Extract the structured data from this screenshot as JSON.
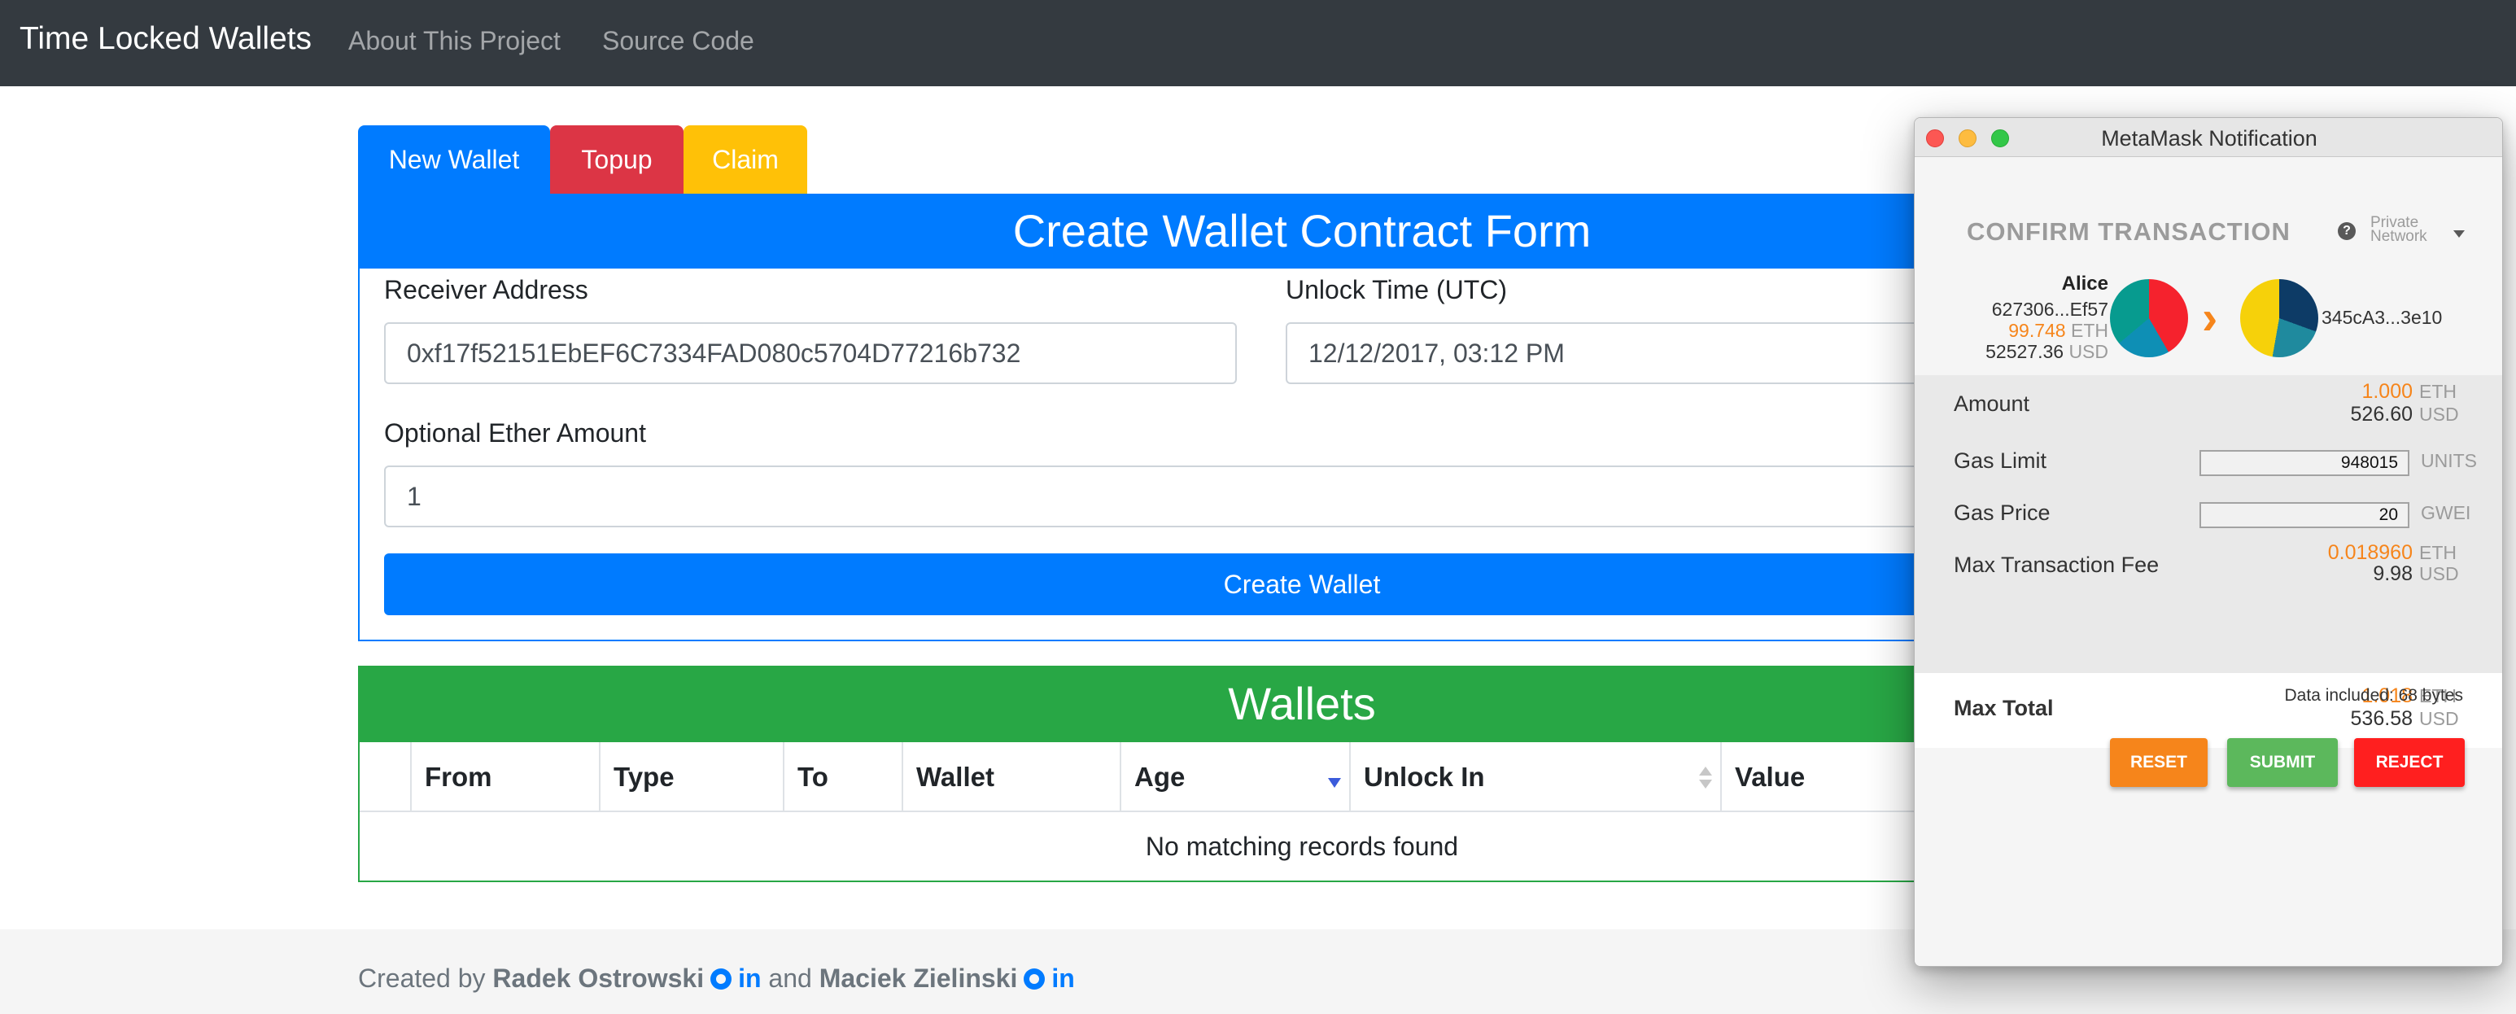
{
  "navbar": {
    "brand": "Time Locked Wallets",
    "links": [
      "About This Project",
      "Source Code"
    ]
  },
  "tabs": {
    "new_wallet": "New Wallet",
    "topup": "Topup",
    "claim": "Claim"
  },
  "form": {
    "title": "Create Wallet Contract Form",
    "receiver_label": "Receiver Address",
    "receiver_value": "0xf17f52151EbEF6C7334FAD080c5704D77216b732",
    "unlock_label": "Unlock Time (UTC)",
    "unlock_value": "12/12/2017, 03:12 PM",
    "amount_label": "Optional Ether Amount",
    "amount_value": "1",
    "submit_label": "Create Wallet"
  },
  "wallets": {
    "title": "Wallets",
    "columns": [
      "From",
      "Type",
      "To",
      "Wallet",
      "Age",
      "Unlock In",
      "Value"
    ],
    "empty_message": "No matching records found"
  },
  "footer": {
    "prefix": "Created by",
    "author1": "Radek Ostrowski",
    "joiner": "and",
    "author2": "Maciek Zielinski",
    "linkedin_label": "in"
  },
  "metamask": {
    "window_title": "MetaMask Notification",
    "heading": "CONFIRM TRANSACTION",
    "network_line1": "Private",
    "network_line2": "Network",
    "from": {
      "name": "Alice",
      "address": "627306...Ef57",
      "eth_balance": "99.748",
      "eth_unit": "ETH",
      "usd_balance": "52527.36",
      "usd_unit": "USD"
    },
    "to_address": "345cA3...3e10",
    "amount": {
      "label": "Amount",
      "eth": "1.000",
      "usd": "526.60"
    },
    "gas_limit": {
      "label": "Gas Limit",
      "value": "948015",
      "unit": "UNITS"
    },
    "gas_price": {
      "label": "Gas Price",
      "value": "20",
      "unit": "GWEI"
    },
    "max_fee": {
      "label": "Max Transaction Fee",
      "eth": "0.018960",
      "usd": "9.98"
    },
    "max_total": {
      "label": "Max Total",
      "eth": "1.018",
      "usd": "536.58"
    },
    "units": {
      "eth": "ETH",
      "usd": "USD"
    },
    "data_included": "Data included: 68 bytes",
    "buttons": {
      "reset": "RESET",
      "submit": "SUBMIT",
      "reject": "REJECT"
    }
  },
  "colors": {
    "navbar": "#343a40",
    "primary": "#007bff",
    "danger": "#dc3545",
    "warning": "#ffc107",
    "success": "#28a745",
    "metamask_orange": "#f6851b",
    "submit_green": "#5cb85c",
    "reject_red": "#ff1f1f"
  }
}
